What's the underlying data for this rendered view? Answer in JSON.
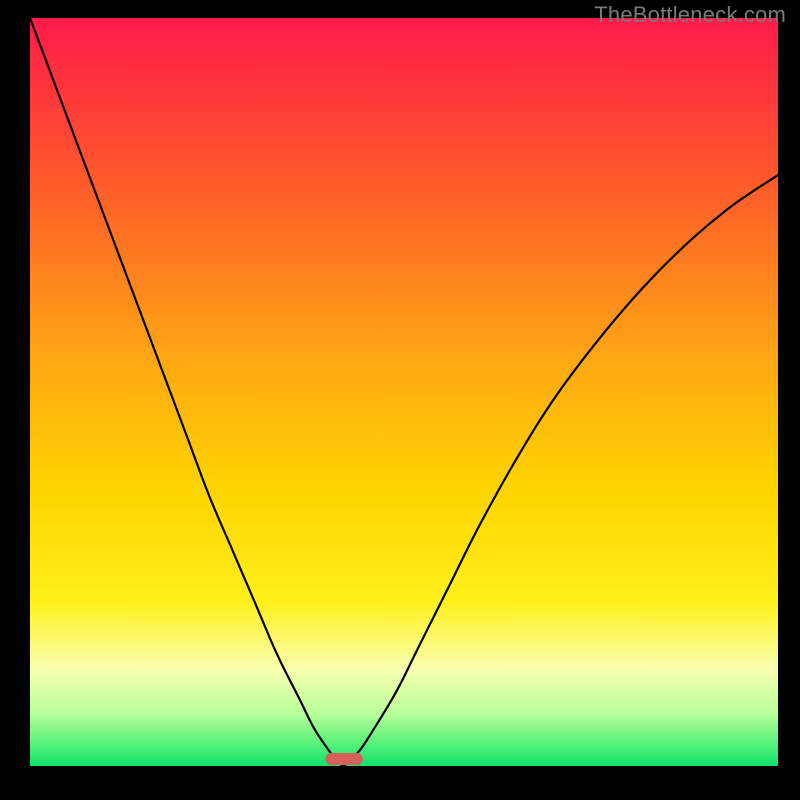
{
  "watermark": "TheBottleneck.com",
  "chart_data": {
    "type": "line",
    "title": "",
    "xlabel": "",
    "ylabel": "",
    "xlim": [
      0,
      100
    ],
    "ylim": [
      0,
      100
    ],
    "grid": false,
    "legend": false,
    "description": "Bottleneck curve: two black branches descending steeply from top-left and upper-right toward a minimum near x≈42 over a vertical red→orange→yellow→green gradient background with a small rounded reddish marker at the minimum on the x-axis.",
    "minimum_x": 42,
    "gradient_stops": [
      {
        "offset": 0,
        "color": "#ff1a4a"
      },
      {
        "offset": 22,
        "color": "#ff5a2a"
      },
      {
        "offset": 45,
        "color": "#ffa514"
      },
      {
        "offset": 63,
        "color": "#ffd400"
      },
      {
        "offset": 78,
        "color": "#fff01a"
      },
      {
        "offset": 87,
        "color": "#faffb0"
      },
      {
        "offset": 93,
        "color": "#b8ff9a"
      },
      {
        "offset": 97,
        "color": "#57f27a"
      },
      {
        "offset": 100,
        "color": "#12e06a"
      }
    ],
    "marker": {
      "x": 42,
      "width": 5,
      "height": 1.6,
      "color": "#d6605a"
    },
    "series": [
      {
        "name": "left-branch",
        "x": [
          0,
          3,
          6,
          9,
          12,
          15,
          18,
          21,
          24,
          27,
          30,
          33,
          36,
          38,
          40,
          41,
          42
        ],
        "y": [
          100,
          92,
          84,
          76,
          68,
          60,
          52,
          44,
          36,
          29,
          22,
          15,
          9,
          5,
          2,
          0.6,
          0
        ]
      },
      {
        "name": "right-branch",
        "x": [
          42,
          44,
          46,
          49,
          52,
          56,
          60,
          65,
          70,
          76,
          82,
          88,
          94,
          100
        ],
        "y": [
          0,
          2,
          5,
          10,
          16,
          24,
          32,
          41,
          49,
          57,
          64,
          70,
          75,
          79
        ]
      }
    ]
  }
}
